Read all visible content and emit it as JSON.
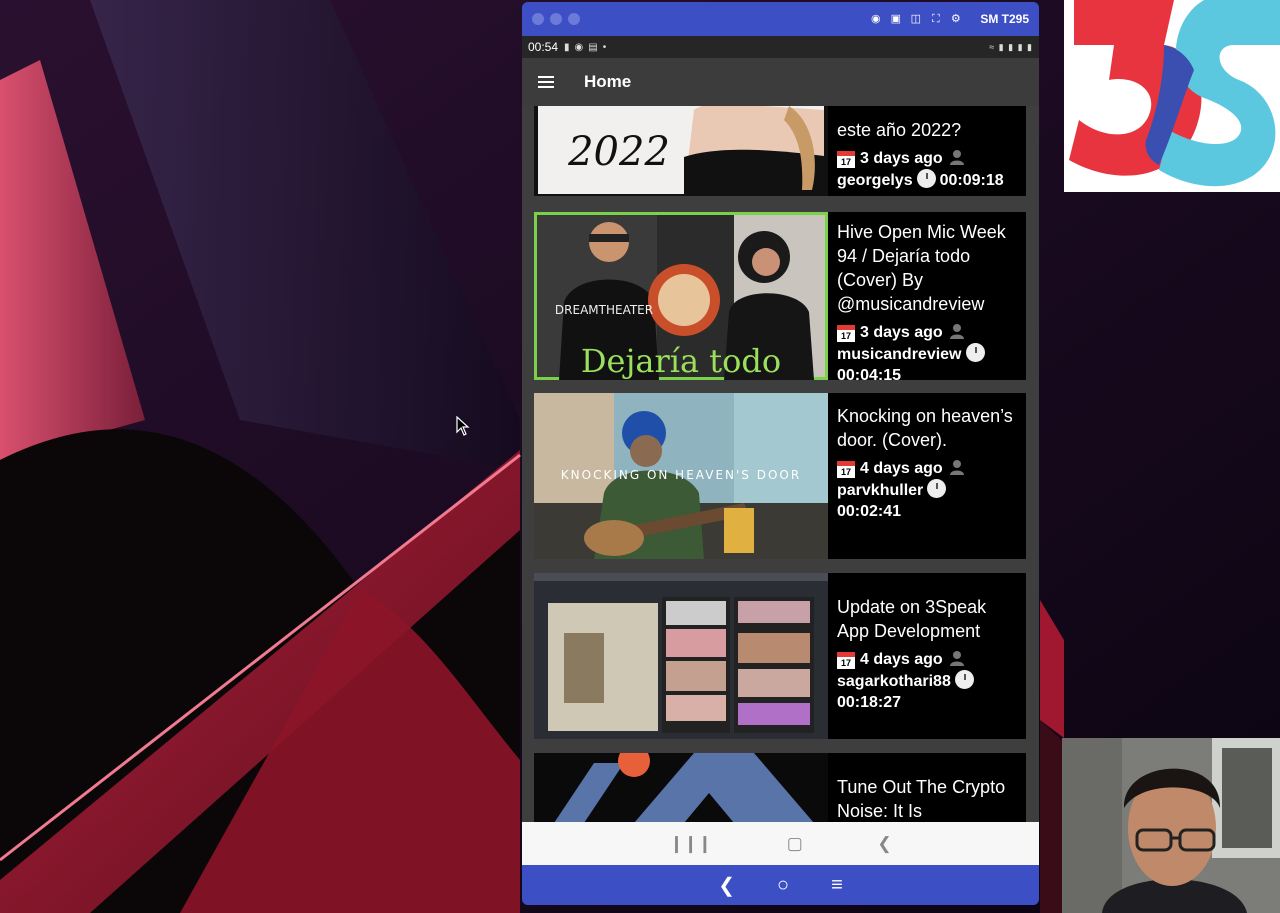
{
  "mirror_window": {
    "device_name": "SM T295",
    "tool_icons": [
      "camera-icon",
      "video-icon",
      "headphones-icon",
      "fullscreen-icon",
      "gear-icon"
    ]
  },
  "status_bar": {
    "time": "00:54"
  },
  "app_bar": {
    "title": "Home"
  },
  "videos": [
    {
      "title": "este año 2022?",
      "thumb_text": "2022",
      "date": "3 days ago",
      "author": "georgelys",
      "duration": "00:09:18"
    },
    {
      "title": "Hive Open Mic Week 94 / Dejaría todo (Cover) By @musicandreview",
      "thumb_text": "Dejaría todo",
      "thumb_text_2": "DREAMTHEATER",
      "date": "3 days ago",
      "author": "musicandreview",
      "duration": "00:04:15"
    },
    {
      "title": "Knocking on heaven’s door. (Cover).",
      "thumb_text": "KNOCKING ON HEAVEN'S DOOR",
      "date": "4 days ago",
      "author": "parvkhuller",
      "duration": "00:02:41"
    },
    {
      "title": "Update on 3Speak App Development",
      "date": "4 days ago",
      "author": "sagarkothari88",
      "duration": "00:18:27"
    },
    {
      "title": "Tune Out The Crypto Noise: It Is"
    }
  ],
  "calendar_icon_text": "17",
  "colors": {
    "window_bar": "#3d4fc4",
    "app_bar": "#3c3c3c",
    "card_bg": "#000000",
    "logo_red": "#e8343f",
    "logo_blue": "#3a4fb0",
    "logo_cyan": "#5bc8e0"
  }
}
